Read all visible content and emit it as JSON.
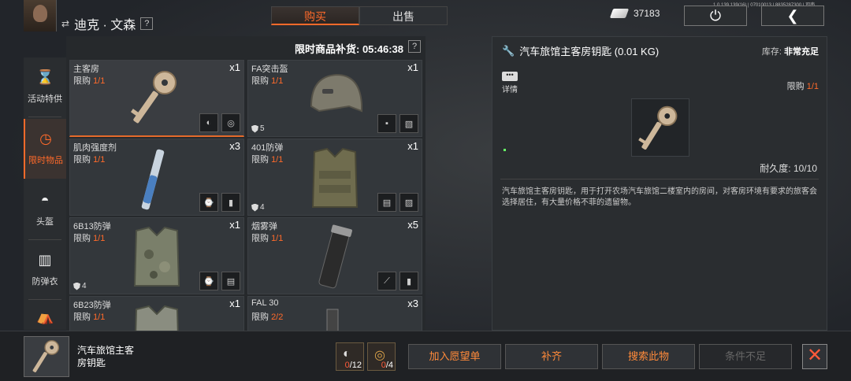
{
  "header": {
    "player_name": "迪克 · 文森",
    "swap_icon": "swap-icon",
    "help": "?",
    "debug_line": "1.0.139.139(16) | 07010013 | 8835287300 | 司南",
    "tabs": [
      {
        "label": "购买",
        "active": true
      },
      {
        "label": "出售",
        "active": false
      }
    ],
    "currency_amount": "37183",
    "accent_color": "#ff6a2a"
  },
  "sidebar": {
    "items": [
      {
        "label": "活动特供",
        "icon": "hourglass-icon",
        "active": false
      },
      {
        "label": "限时物品",
        "icon": "clock-icon",
        "active": true
      },
      {
        "label": "头盔",
        "icon": "helmet-icon",
        "active": false
      },
      {
        "label": "防弹衣",
        "icon": "vest-icon",
        "active": false
      }
    ]
  },
  "shop": {
    "restock_label": "限时商品补货: 05:46:38",
    "help": "?",
    "items": [
      {
        "name": "主客房",
        "limit_label": "限购",
        "limit": "1/1",
        "qty": "x1",
        "art": "key",
        "armor": ""
      },
      {
        "name": "FA突击盔",
        "limit_label": "限购",
        "limit": "1/1",
        "qty": "x1",
        "art": "helmet",
        "armor": "5"
      },
      {
        "name": "肌肉强度剂",
        "limit_label": "限购",
        "limit": "1/1",
        "qty": "x3",
        "art": "syringe",
        "armor": ""
      },
      {
        "name": "401防弹",
        "limit_label": "限购",
        "limit": "1/1",
        "qty": "x1",
        "art": "vest",
        "armor": "4"
      },
      {
        "name": "6B13防弹",
        "limit_label": "限购",
        "limit": "1/1",
        "qty": "x1",
        "art": "camo-vest",
        "armor": "4"
      },
      {
        "name": "烟雾弹",
        "limit_label": "限购",
        "limit": "1/1",
        "qty": "x5",
        "art": "smoke",
        "armor": ""
      },
      {
        "name": "6B23防弹",
        "limit_label": "限购",
        "limit": "1/1",
        "qty": "x1",
        "art": "camo-vest",
        "armor": ""
      },
      {
        "name": "FAL 30",
        "limit_label": "限购",
        "limit": "2/2",
        "qty": "x3",
        "art": "magazine",
        "armor": ""
      }
    ]
  },
  "detail": {
    "title": "汽车旅馆主客房钥匙 (0.01 KG)",
    "stock_label": "库存:",
    "stock_value": "非常充足",
    "info_label": "详情",
    "limit_label": "限购",
    "limit_value": "1/1",
    "durability": "耐久度: 10/10",
    "description": "汽车旅馆主客房钥匙，用于打开农场汽车旅馆二楼室内的房间，对客房环境有要求的旅客会选择居住，有大量价格不菲的遗留物。"
  },
  "bottom": {
    "selected_name": "汽车旅馆主客房钥匙",
    "requirements": [
      {
        "have": "0",
        "need": "/12"
      },
      {
        "have": "0",
        "need": "/4"
      }
    ],
    "actions": {
      "wishlist": "加入愿望单",
      "fill": "补齐",
      "search": "搜索此物",
      "condition": "条件不足"
    },
    "close_icon": "close-icon"
  }
}
